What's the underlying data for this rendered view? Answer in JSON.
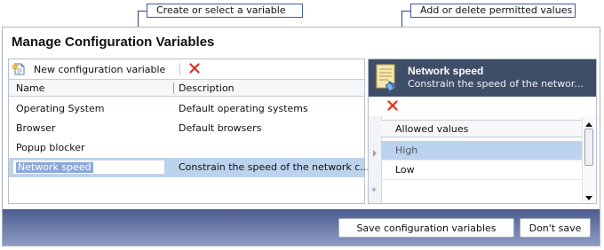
{
  "callouts": {
    "left": "Create or select a variable",
    "right": "Add or delete permitted values"
  },
  "window": {
    "title": "Manage Configuration Variables"
  },
  "toolbar": {
    "new_label": "New configuration variable"
  },
  "grid": {
    "columns": [
      "Name",
      "Description"
    ],
    "rows": [
      {
        "name": "Operating System",
        "description": "Default operating systems"
      },
      {
        "name": "Browser",
        "description": "Default browsers"
      },
      {
        "name": "Popup blocker",
        "description": ""
      },
      {
        "name": "Network speed",
        "description": "Constrain the speed of the network c..."
      }
    ]
  },
  "details": {
    "title": "Network speed",
    "subtitle": "Constrain the speed of the networ...",
    "column": "Allowed values",
    "values": [
      "High",
      "Low"
    ],
    "new_row_marker": "*"
  },
  "buttons": {
    "save": "Save configuration variables",
    "cancel": "Don't save"
  },
  "colors": {
    "delete": "#e0301e",
    "selection": "#bcd3ee",
    "header_bg": "#3f4e68"
  }
}
